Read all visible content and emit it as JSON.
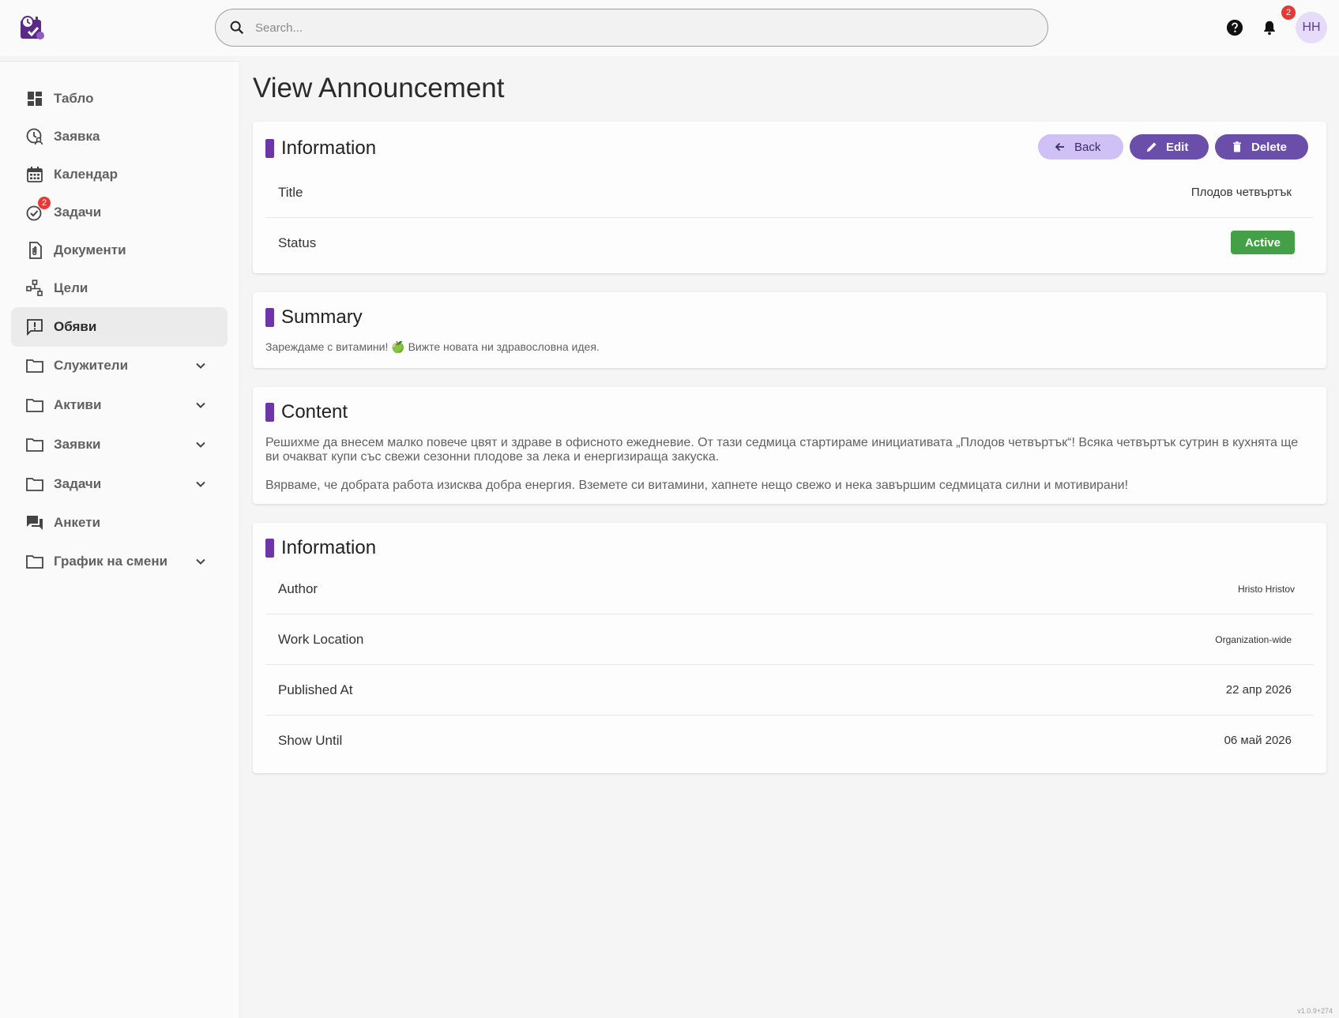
{
  "search": {
    "placeholder": "Search..."
  },
  "header": {
    "notifications_count": "2",
    "avatar_initials": "HH"
  },
  "sidebar": {
    "items": [
      {
        "label": "Табло",
        "icon": "dashboard-icon"
      },
      {
        "label": "Заявка",
        "icon": "time-request-icon"
      },
      {
        "label": "Календар",
        "icon": "calendar-icon"
      },
      {
        "label": "Задачи",
        "icon": "task-check-icon",
        "badge": "2"
      },
      {
        "label": "Документи",
        "icon": "document-icon"
      },
      {
        "label": "Цели",
        "icon": "goals-icon"
      },
      {
        "label": "Обяви",
        "icon": "announcement-icon",
        "active": true
      },
      {
        "label": "Служители",
        "icon": "folder-icon",
        "expandable": true
      },
      {
        "label": "Активи",
        "icon": "folder-icon",
        "expandable": true
      },
      {
        "label": "Заявки",
        "icon": "folder-icon",
        "expandable": true
      },
      {
        "label": "Задачи",
        "icon": "folder-icon",
        "expandable": true
      },
      {
        "label": "Анкети",
        "icon": "forum-icon"
      },
      {
        "label": "График на смени",
        "icon": "folder-icon",
        "expandable": true
      }
    ]
  },
  "main": {
    "page_title": "View Announcement",
    "info_card": {
      "title": "Information",
      "buttons": {
        "back": "Back",
        "edit": "Edit",
        "delete": "Delete"
      },
      "rows": [
        {
          "key": "Title",
          "value": "Плодов четвъртък"
        },
        {
          "key": "Status",
          "value": "Active"
        }
      ],
      "status_color": "#43a047"
    },
    "summary_card": {
      "title": "Summary",
      "text": "Зареждаме с витамини! 🍏 Вижте новата ни здравословна идея."
    },
    "content_card": {
      "title": "Content",
      "paragraphs": [
        "Решихме да внесем малко повече цвят и здраве в офисното ежедневие. От тази седмица стартираме инициативата „Плодов четвъртък“! Всяка четвъртък сутрин в кухнята ще ви очакват купи със свежи сезонни плодове за лека и енергизираща закуска.",
        "Вярваме, че добрата работа изисква добра енергия. Вземете си витамини, хапнете нещо свежо и нека завършим седмицата силни и мотивирани!"
      ]
    },
    "meta_card": {
      "title": "Information",
      "rows": [
        {
          "key": "Author",
          "value": "Hristo Hristov"
        },
        {
          "key": "Work Location",
          "value": "Organization-wide"
        },
        {
          "key": "Published At",
          "value": "22 апр 2026"
        },
        {
          "key": "Show Until",
          "value": "06 май 2026"
        }
      ]
    }
  },
  "footer": {
    "version": "v1.0.9+274"
  },
  "colors": {
    "accent": "#6d35a8",
    "button_primary": "#6a4ea9",
    "button_secondary": "#cfc0f6"
  }
}
